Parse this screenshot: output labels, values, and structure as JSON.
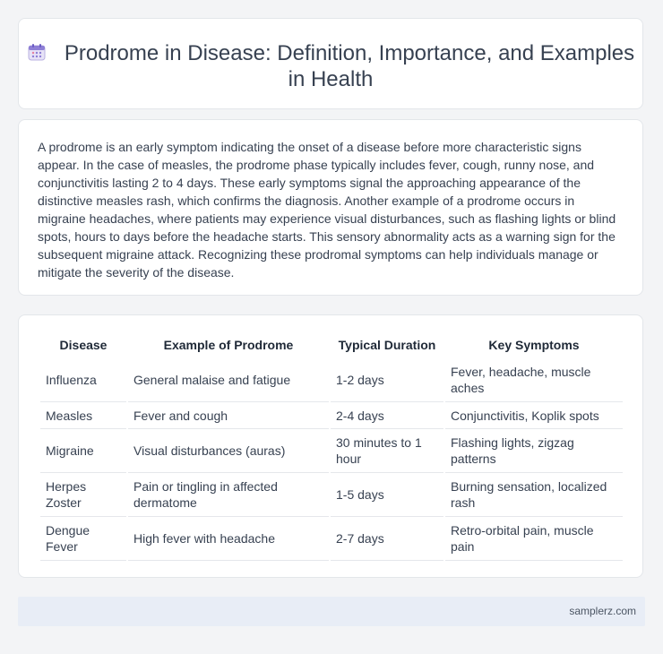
{
  "header": {
    "title": "Prodrome in Disease: Definition, Importance, and Examples in Health",
    "icon": "calendar-icon"
  },
  "body": {
    "paragraph": "A prodrome is an early symptom indicating the onset of a disease before more characteristic signs appear. In the case of measles, the prodrome phase typically includes fever, cough, runny nose, and conjunctivitis lasting 2 to 4 days. These early symptoms signal the approaching appearance of the distinctive measles rash, which confirms the diagnosis. Another example of a prodrome occurs in migraine headaches, where patients may experience visual disturbances, such as flashing lights or blind spots, hours to days before the headache starts. This sensory abnormality acts as a warning sign for the subsequent migraine attack. Recognizing these prodromal symptoms can help individuals manage or mitigate the severity of the disease."
  },
  "table": {
    "headers": [
      "Disease",
      "Example of Prodrome",
      "Typical Duration",
      "Key Symptoms"
    ],
    "rows": [
      [
        "Influenza",
        "General malaise and fatigue",
        "1-2 days",
        "Fever, headache, muscle aches"
      ],
      [
        "Measles",
        "Fever and cough",
        "2-4 days",
        "Conjunctivitis, Koplik spots"
      ],
      [
        "Migraine",
        "Visual disturbances (auras)",
        "30 minutes to 1 hour",
        "Flashing lights, zigzag patterns"
      ],
      [
        "Herpes Zoster",
        "Pain or tingling in affected dermatome",
        "1-5 days",
        "Burning sensation, localized rash"
      ],
      [
        "Dengue Fever",
        "High fever with headache",
        "2-7 days",
        "Retro-orbital pain, muscle pain"
      ]
    ]
  },
  "footer": {
    "site": "samplerz.com"
  }
}
